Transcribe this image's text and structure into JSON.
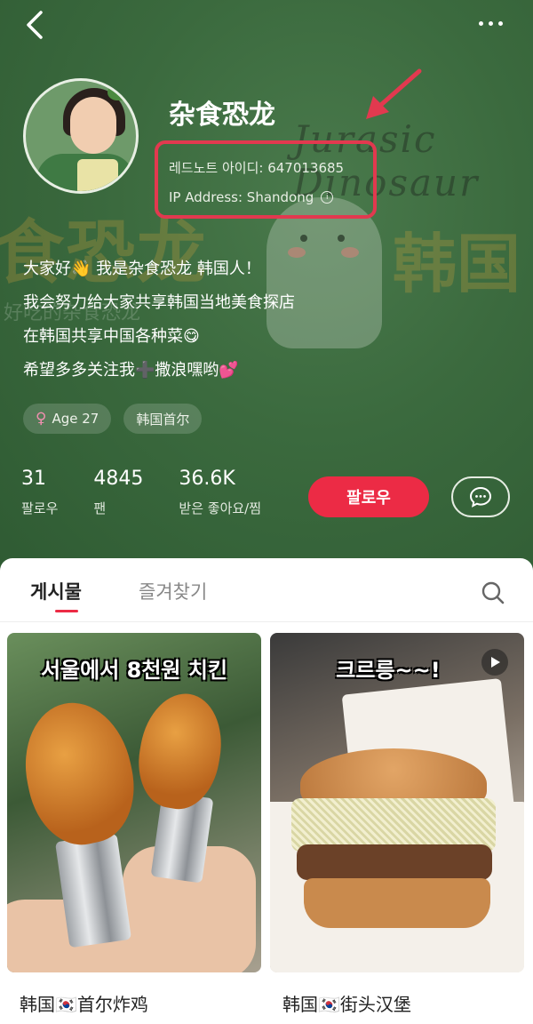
{
  "profile": {
    "nickname": "杂食恐龙",
    "red_id": "레드노트 아이디: 647013685",
    "ip_address": "IP Address: Shandong",
    "bio": [
      "大家好👋 我是杂食恐龙 韩国人！",
      "我会努力给大家共享韩国当地美食探店",
      "在韩国共享中国各种菜😋",
      "希望多多关注我➕撒浪嘿哟💕"
    ],
    "tags": {
      "gender_age": "Age 27",
      "location": "韩国首尔"
    },
    "stats": [
      {
        "value": "31",
        "label": "팔로우"
      },
      {
        "value": "4845",
        "label": "팬"
      },
      {
        "value": "36.6K",
        "label": "받은 좋아요/찜"
      }
    ],
    "follow_label": "팔로우"
  },
  "background": {
    "deco_big_left": "食恐龙",
    "deco_big_right": "韩国",
    "deco_small": "好吃的杂食恐龙",
    "script_text": "Jurasic Dinosaur"
  },
  "tabs": {
    "posts": "게시물",
    "favorites": "즐겨찾기"
  },
  "posts": [
    {
      "overlay": "서울에서 8천원 치킨",
      "title": "韩国🇰🇷首尔炸鸡"
    },
    {
      "overlay": "크르릉~~!",
      "title": "韩国🇰🇷街头汉堡"
    }
  ],
  "colors": {
    "header_bg": "#3b6a3e",
    "accent_red": "#ec2b45",
    "highlight_box": "#e2394f"
  },
  "icons": [
    "back-arrow-icon",
    "more-dots-icon",
    "info-icon",
    "female-icon",
    "chat-bubble-icon",
    "search-icon",
    "play-icon"
  ]
}
